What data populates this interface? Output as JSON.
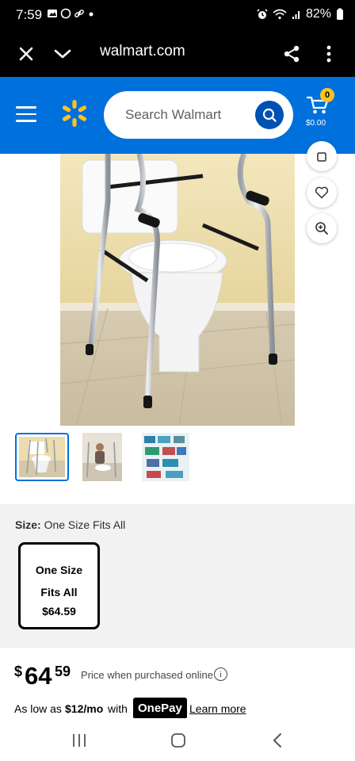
{
  "status_bar": {
    "time": "7:59",
    "battery": "82%"
  },
  "browser": {
    "url": "walmart.com",
    "icons": [
      "close-icon",
      "chevron-down-icon",
      "share-icon",
      "more-vertical-icon"
    ]
  },
  "header": {
    "brand_color": "#0071dc",
    "search_placeholder": "Search Walmart",
    "cart_count": "0",
    "cart_total": "$0.00",
    "icons": [
      "menu-icon",
      "walmart-spark-icon",
      "search-icon",
      "cart-icon"
    ]
  },
  "product": {
    "image_icons": [
      "share-icon",
      "heart-icon",
      "zoom-in-icon"
    ],
    "thumbnails": [
      "thumbnail-1",
      "thumbnail-2",
      "thumbnail-3"
    ],
    "selected_thumbnail": 0
  },
  "size": {
    "label": "Size:",
    "value": "One Size Fits All",
    "option_line1": "One Size",
    "option_line2": "Fits All",
    "option_price": "$64.59"
  },
  "price": {
    "currency": "$",
    "dollars": "64",
    "cents": "59",
    "note": "Price when purchased online",
    "info_glyph": "i"
  },
  "onepay": {
    "prefix": "As low as",
    "amount": "$12/mo",
    "with": "with",
    "badge": "OnePay",
    "learn_more": "Learn more"
  }
}
